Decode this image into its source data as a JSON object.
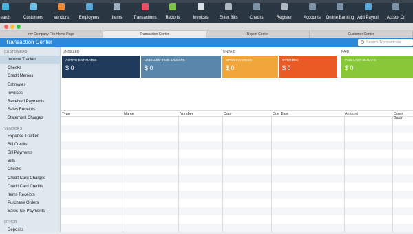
{
  "toolbar": {
    "items": [
      {
        "label": "earch",
        "icon": "search-icon",
        "color": "#4ab6e0"
      },
      {
        "label": "Customers",
        "icon": "customers-icon",
        "color": "#6ec0e8"
      },
      {
        "label": "Vendors",
        "icon": "vendors-icon",
        "color": "#f08a34"
      },
      {
        "label": "Employees",
        "icon": "employees-icon",
        "color": "#5aa9dc"
      },
      {
        "label": "Items",
        "icon": "items-icon",
        "color": "#9cb1c1"
      },
      {
        "label": "Transactions",
        "icon": "transactions-icon",
        "color": "#f04e63"
      },
      {
        "label": "Reports",
        "icon": "reports-icon",
        "color": "#7cc349"
      },
      {
        "label": "Invoices",
        "icon": "invoices-icon",
        "color": "#d7e0e7"
      },
      {
        "label": "Enter Bills",
        "icon": "bills-icon",
        "color": "#aeb8c1"
      },
      {
        "label": "Checks",
        "icon": "checks-icon",
        "color": "#7c93a7"
      },
      {
        "label": "Register",
        "icon": "register-icon",
        "color": "#aeb8c1"
      },
      {
        "label": "Accounts",
        "icon": "accounts-icon",
        "color": "#7c93a7"
      },
      {
        "label": "Online Banking",
        "icon": "online-banking-icon",
        "color": "#7c93a7"
      },
      {
        "label": "Add Payroll",
        "icon": "payroll-icon",
        "color": "#5aa9dc"
      },
      {
        "label": "Accept Cr",
        "icon": "credit-card-icon",
        "color": "#7c93a7"
      }
    ]
  },
  "tabs": [
    "my Company File Home Page",
    "Transaction Center",
    "Report Center",
    "Customer Center"
  ],
  "header": {
    "title": "Transaction Center",
    "search_placeholder": "Search Transactions"
  },
  "sidebar": {
    "sections": [
      {
        "heading": "CUSTOMERS",
        "items": [
          "Income Tracker",
          "Checks",
          "Credit Memos",
          "Estimates",
          "Invoices",
          "Received Payments",
          "Sales Receipts",
          "Statement Charges"
        ]
      },
      {
        "heading": "VENDORS",
        "items": [
          "Expense Tracker",
          "Bill Credits",
          "Bill Payments",
          "Bills",
          "Checks",
          "Credit Card Charges",
          "Credit Card Credits",
          "Items Receipts",
          "Purchase Orders",
          "Sales Tax Payments"
        ]
      },
      {
        "heading": "OTHER",
        "items": [
          "Deposits"
        ]
      }
    ]
  },
  "summary": {
    "unbilled_label": "UNBILLED",
    "unpaid_label": "UNPAID",
    "paid_label": "PAID",
    "cards": [
      {
        "caption": "ACTIVE ESTIMATES",
        "value": "$ 0",
        "color": "#1f3a5a"
      },
      {
        "caption": "UNBILLED TIME & COSTS",
        "value": "$ 0",
        "color": "#5a86a9"
      },
      {
        "caption": "OPEN INVOICES",
        "value": "$ 0",
        "color": "#f0a63a"
      },
      {
        "caption": "OVERDUE",
        "value": "$ 0",
        "color": "#e95a24"
      },
      {
        "caption": "PAID LAST 30 DAYS",
        "value": "$ 0",
        "color": "#88c738"
      }
    ]
  },
  "table": {
    "columns": [
      "Type",
      "Name",
      "Number",
      "Date",
      "Due Date",
      "Amount",
      "Open Balan"
    ]
  }
}
